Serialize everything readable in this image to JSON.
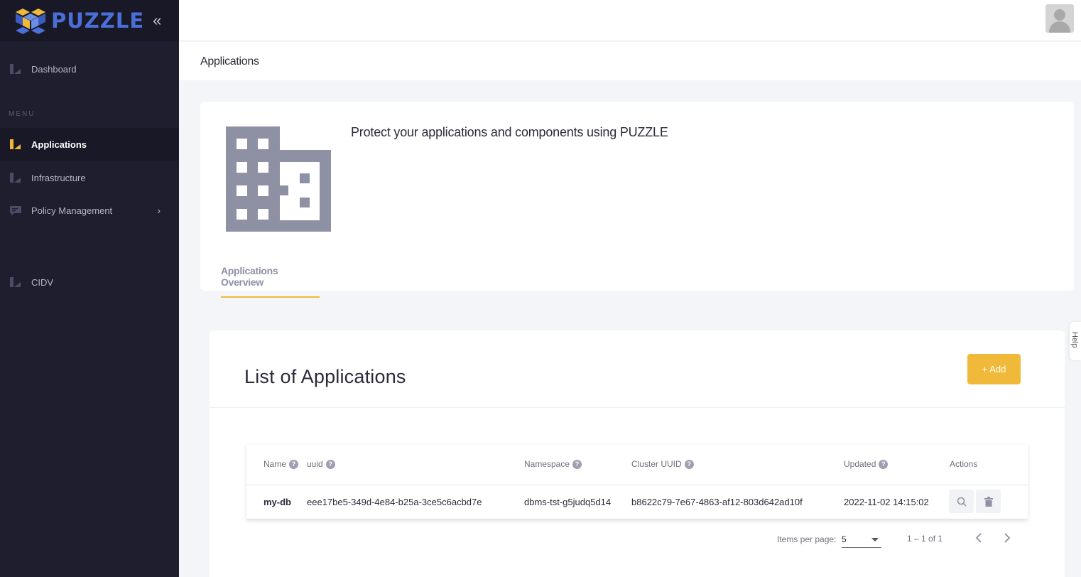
{
  "app": {
    "name": "PUZZLE"
  },
  "sidebar": {
    "collapse_icon": "chevrons-left-icon",
    "section_label": "MENU",
    "items": [
      {
        "label": "Dashboard",
        "icon": "dashboard-icon"
      },
      {
        "label": "Applications",
        "icon": "applications-icon",
        "active": true
      },
      {
        "label": "Infrastructure",
        "icon": "infrastructure-icon"
      },
      {
        "label": "Policy Management",
        "icon": "policy-icon",
        "has_submenu": true
      },
      {
        "label": "CIDV",
        "icon": "cidv-icon"
      }
    ]
  },
  "header": {
    "page_title": "Applications"
  },
  "hero": {
    "title": "Protect your applications and components using PUZZLE",
    "tab": "Applications Overview"
  },
  "help_tab": {
    "label": "Help"
  },
  "list": {
    "title": "List of Applications",
    "add_label": "+ Add",
    "columns": [
      "Name",
      "uuid",
      "Namespace",
      "Cluster UUID",
      "Updated",
      "Actions"
    ],
    "rows": [
      {
        "name": "my-db",
        "uuid": "eee17be5-349d-4e84-b25a-3ce5c6acbd7e",
        "namespace": "dbms-tst-g5judq5d14",
        "cluster_uuid": "b8622c79-7e67-4863-af12-803d642ad10f",
        "updated": "2022-11-02 14:15:02"
      }
    ],
    "pagination": {
      "items_per_page_label": "Items per page:",
      "items_per_page": "5",
      "range": "1 – 1 of 1"
    }
  },
  "colors": {
    "sidebar_bg": "#1f1e2e",
    "accent": "#f1b939",
    "brand_blue": "#4a6fd8"
  }
}
